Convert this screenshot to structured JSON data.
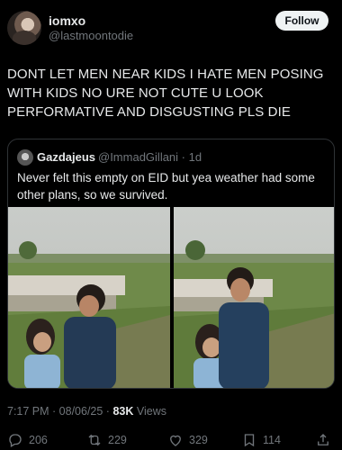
{
  "header": {
    "display_name": "iomxo",
    "handle": "@lastmoontodie",
    "follow_label": "Follow"
  },
  "tweet": {
    "text": "DONT LET MEN NEAR KIDS I HATE MEN POSING WITH KIDS NO URE NOT CUTE U LOOK PERFORMATIVE AND DISGUSTING PLS DIE"
  },
  "quote": {
    "display_name": "Gazdajeus",
    "handle_time": "@ImmadGillani · 1d",
    "text": "Never felt this empty on EID but yea weather had some other plans, so we survived."
  },
  "meta": {
    "time_date": "7:17 PM · 08/06/25 · ",
    "views_count": "83K",
    "views_label": " Views"
  },
  "actions": {
    "replies": "206",
    "reposts": "229",
    "likes": "329",
    "bookmarks": "114"
  },
  "colors": {
    "background": "#000000",
    "text_primary": "#e7e9ea",
    "text_secondary": "#71767b",
    "border": "#2f3336"
  }
}
